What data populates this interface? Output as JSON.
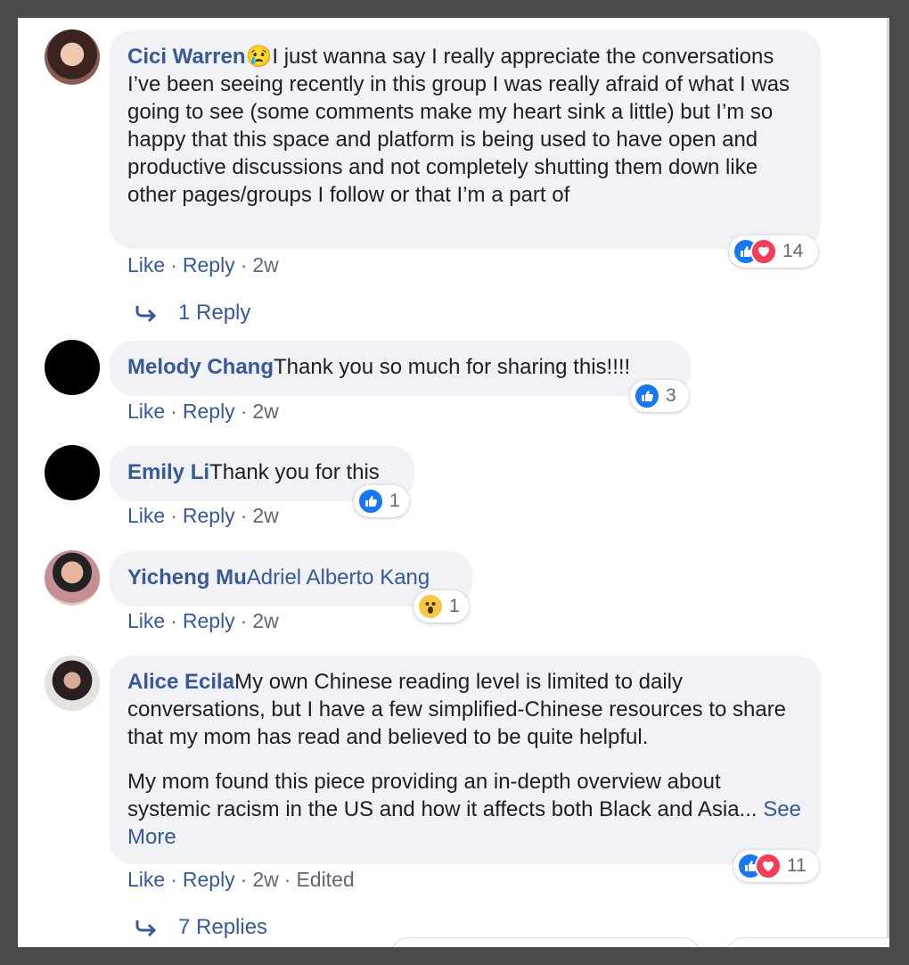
{
  "comments": [
    {
      "author": "Cici Warren",
      "emoji": "😢",
      "text": "I just wanna say I really appreciate the conversations I’ve been seeing recently in this group I was really afraid of what I was going to see (some comments make my heart sink a little) but I’m so happy that this space and platform is being used to have open and productive discussions and not completely shutting them down like other pages/groups I follow or that I’m a part of",
      "like": "Like",
      "reply": "Reply",
      "time": "2w",
      "reaction_count": "14",
      "reaction_icons": [
        "like-icon",
        "love-icon"
      ],
      "replies_label": "1 Reply"
    },
    {
      "author": "Melody Chang",
      "text": "Thank you so much for sharing this!!!!",
      "like": "Like",
      "reply": "Reply",
      "time": "2w",
      "reaction_count": "3",
      "reaction_icons": [
        "like-icon"
      ]
    },
    {
      "author": "Emily Li",
      "text": "Thank you for this",
      "like": "Like",
      "reply": "Reply",
      "time": "2w",
      "reaction_count": "1",
      "reaction_icons": [
        "like-icon"
      ]
    },
    {
      "author": "Yicheng Mu",
      "mention": "Adriel Alberto Kang",
      "like": "Like",
      "reply": "Reply",
      "time": "2w",
      "reaction_count": "1",
      "reaction_icons": [
        "wow-icon"
      ]
    },
    {
      "author": "Alice Ecila",
      "text_p1": "My own Chinese reading level is limited to daily conversations, but I have a few simplified-Chinese resources to share that my mom has read and believed to be quite helpful.",
      "text_p2": "My mom found this piece providing an in-depth overview about systemic racism in the US and how it affects both Black and Asia...",
      "see_more": "See More",
      "like": "Like",
      "reply": "Reply",
      "time": "2w",
      "edited": "Edited",
      "reaction_count": "11",
      "reaction_icons": [
        "like-icon",
        "love-icon"
      ],
      "replies_label": "7 Replies"
    }
  ],
  "colors": {
    "link": "#385898",
    "bubble": "#f0f2f5",
    "like": "#1877f2",
    "love": "#f33e58",
    "wow": "#f7c846",
    "frame": "#4a4a4a"
  }
}
